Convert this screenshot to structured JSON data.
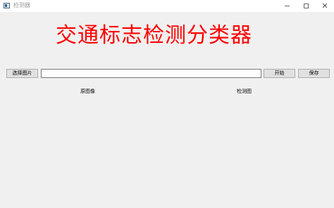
{
  "window": {
    "title": "检测器",
    "controls": {
      "minimize": "minimize-icon",
      "maximize": "maximize-icon",
      "close": "close-icon"
    },
    "close_glyph": "✕"
  },
  "header": {
    "title": "交通标志检测分类器",
    "color": "#ff0000"
  },
  "toolbar": {
    "select_label": "选择图片",
    "path_value": "",
    "start_label": "开始",
    "save_label": "保存"
  },
  "panels": {
    "original_label": "原图像",
    "detected_label": "检测图"
  }
}
